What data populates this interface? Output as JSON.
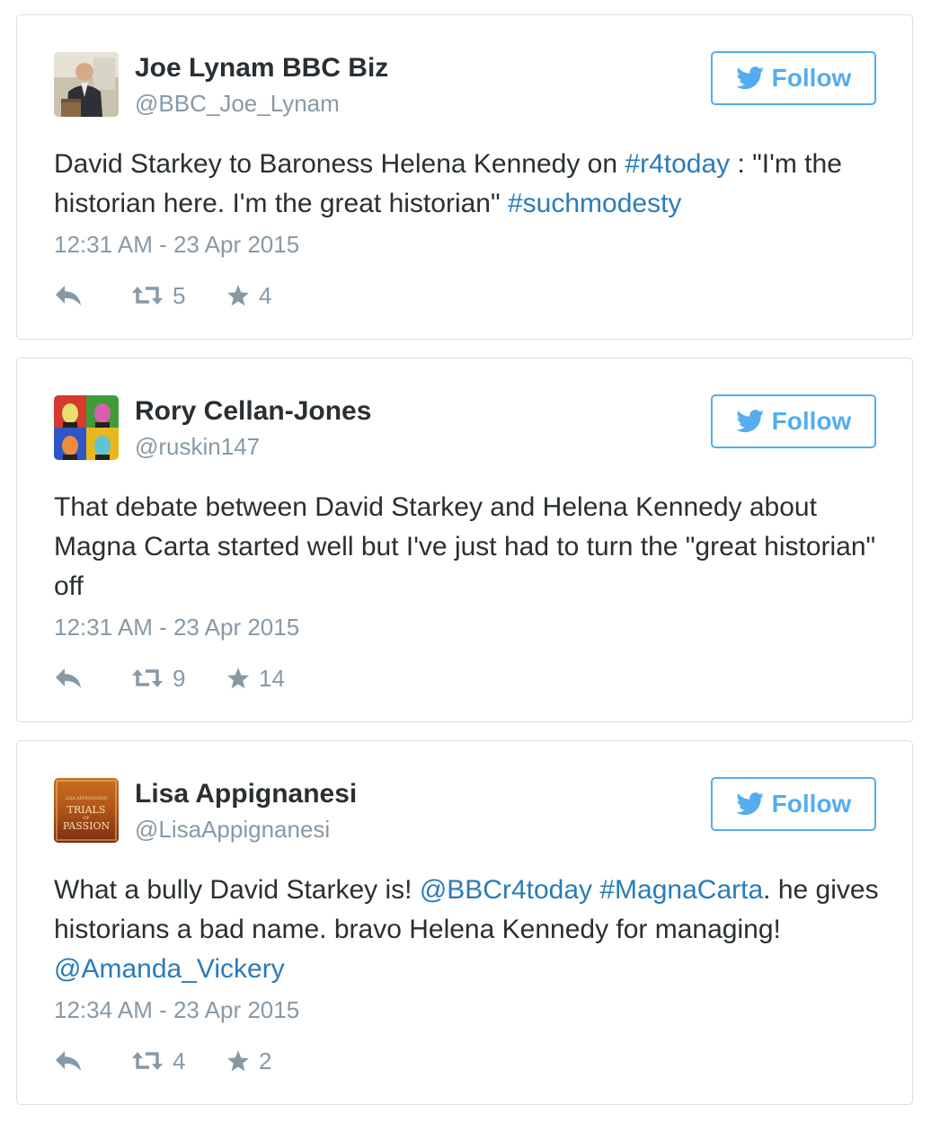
{
  "tweets": [
    {
      "name": "Joe Lynam BBC Biz",
      "handle": "@BBC_Joe_Lynam",
      "follow_label": "Follow",
      "text": [
        {
          "t": "David Starkey to Baroness Helena Kennedy on ",
          "link": false
        },
        {
          "t": "#r4today",
          "link": true
        },
        {
          "t": " : \"I'm the historian here. I'm the great historian\"  ",
          "link": false
        },
        {
          "t": "#suchmodesty",
          "link": true
        }
      ],
      "date": "12:31 AM - 23 Apr 2015",
      "retweets": "5",
      "favorites": "4"
    },
    {
      "name": "Rory Cellan-Jones",
      "handle": "@ruskin147",
      "follow_label": "Follow",
      "text": [
        {
          "t": "That debate between David Starkey and Helena Kennedy about Magna Carta started well but I've just had to turn the \"great historian\" off",
          "link": false
        }
      ],
      "date": "12:31 AM - 23 Apr 2015",
      "retweets": "9",
      "favorites": "14"
    },
    {
      "name": "Lisa Appignanesi",
      "handle": "@LisaAppignanesi",
      "follow_label": "Follow",
      "avatar_text": [
        "LISA APPIGNANESI",
        "TRIALS",
        "OF",
        "PASSION"
      ],
      "text": [
        {
          "t": "What a bully David Starkey is! ",
          "link": false
        },
        {
          "t": "@BBCr4today",
          "link": true
        },
        {
          "t": " ",
          "link": false
        },
        {
          "t": "#MagnaCarta",
          "link": true
        },
        {
          "t": ". he gives historians a bad name. bravo Helena Kennedy for managing! ",
          "link": false
        },
        {
          "t": "@Amanda_Vickery",
          "link": true
        }
      ],
      "date": "12:34 AM - 23 Apr 2015",
      "retweets": "4",
      "favorites": "2"
    }
  ],
  "colors": {
    "link": "#2b7bb9",
    "follow_blue": "#55acee",
    "meta_gray": "#8899a6",
    "text": "#292f33"
  },
  "icons": {
    "follow": "twitter-bird-icon",
    "reply": "reply-icon",
    "retweet": "retweet-icon",
    "favorite": "star-icon"
  }
}
